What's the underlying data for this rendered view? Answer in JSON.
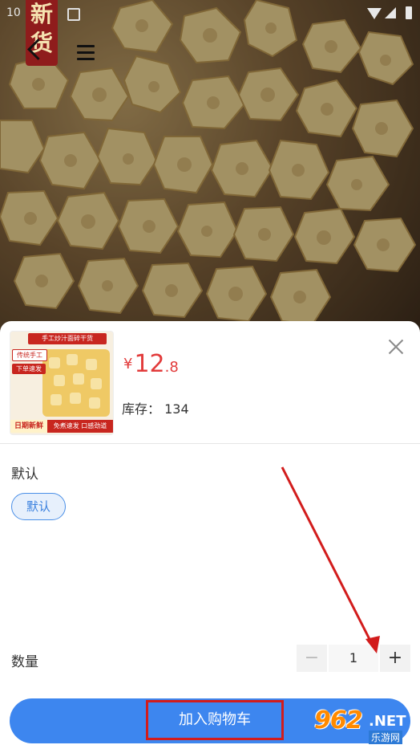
{
  "status_bar": {
    "time": "10"
  },
  "header": {
    "badge_text": "新货"
  },
  "product": {
    "price_currency": "¥",
    "price_int": "12",
    "price_dec": ".8",
    "stock_label": "库存：",
    "stock_value": "134",
    "thumb": {
      "banner": "手工炒汁面碎干货",
      "tag1": "传统手工",
      "tag2": "下单速发",
      "bottom_left": "日期新鲜",
      "bottom_right": "免煮速发 口感劲道"
    }
  },
  "spec": {
    "title": "默认",
    "options": [
      "默认"
    ],
    "selected": "默认"
  },
  "quantity": {
    "label": "数量",
    "minus": "−",
    "value": "1",
    "plus": "+"
  },
  "actions": {
    "add_to_cart": "加入购物车"
  },
  "watermark": {
    "logo": "962",
    "net": ".NET",
    "sub": "乐游网"
  },
  "colors": {
    "primary": "#3d86ef",
    "price": "#e23b3b",
    "annotation": "#d21c1c"
  }
}
